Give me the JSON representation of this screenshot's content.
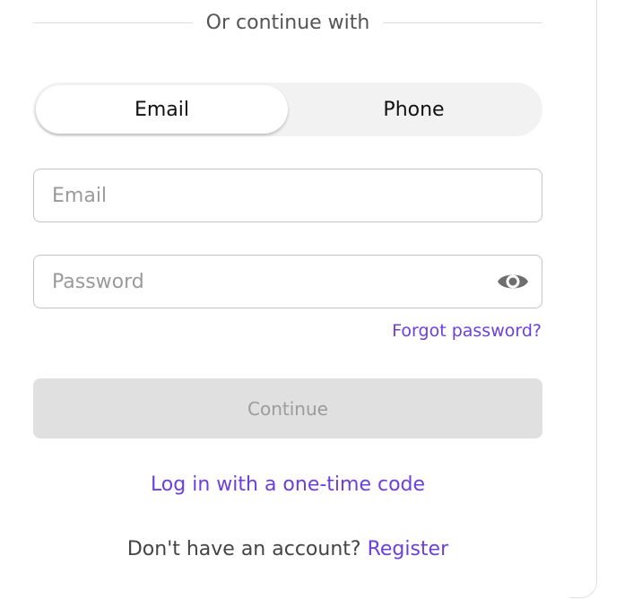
{
  "divider": {
    "text": "Or continue with"
  },
  "method_toggle": {
    "options": [
      {
        "label": "Email",
        "selected": true
      },
      {
        "label": "Phone",
        "selected": false
      }
    ]
  },
  "form": {
    "email_placeholder": "Email",
    "email_value": "",
    "password_placeholder": "Password",
    "password_value": "",
    "password_toggle_icon": "eye-icon",
    "forgot_password_label": "Forgot password?",
    "continue_label": "Continue",
    "continue_enabled": false
  },
  "alt_login": {
    "one_time_code_label": "Log in with a one-time code"
  },
  "register": {
    "prompt": "Don't have an account?",
    "link_label": "Register"
  },
  "colors": {
    "accent": "#6b3fe0",
    "button_disabled_bg": "#e0e0e0",
    "toggle_bg": "#f2f2f2"
  }
}
